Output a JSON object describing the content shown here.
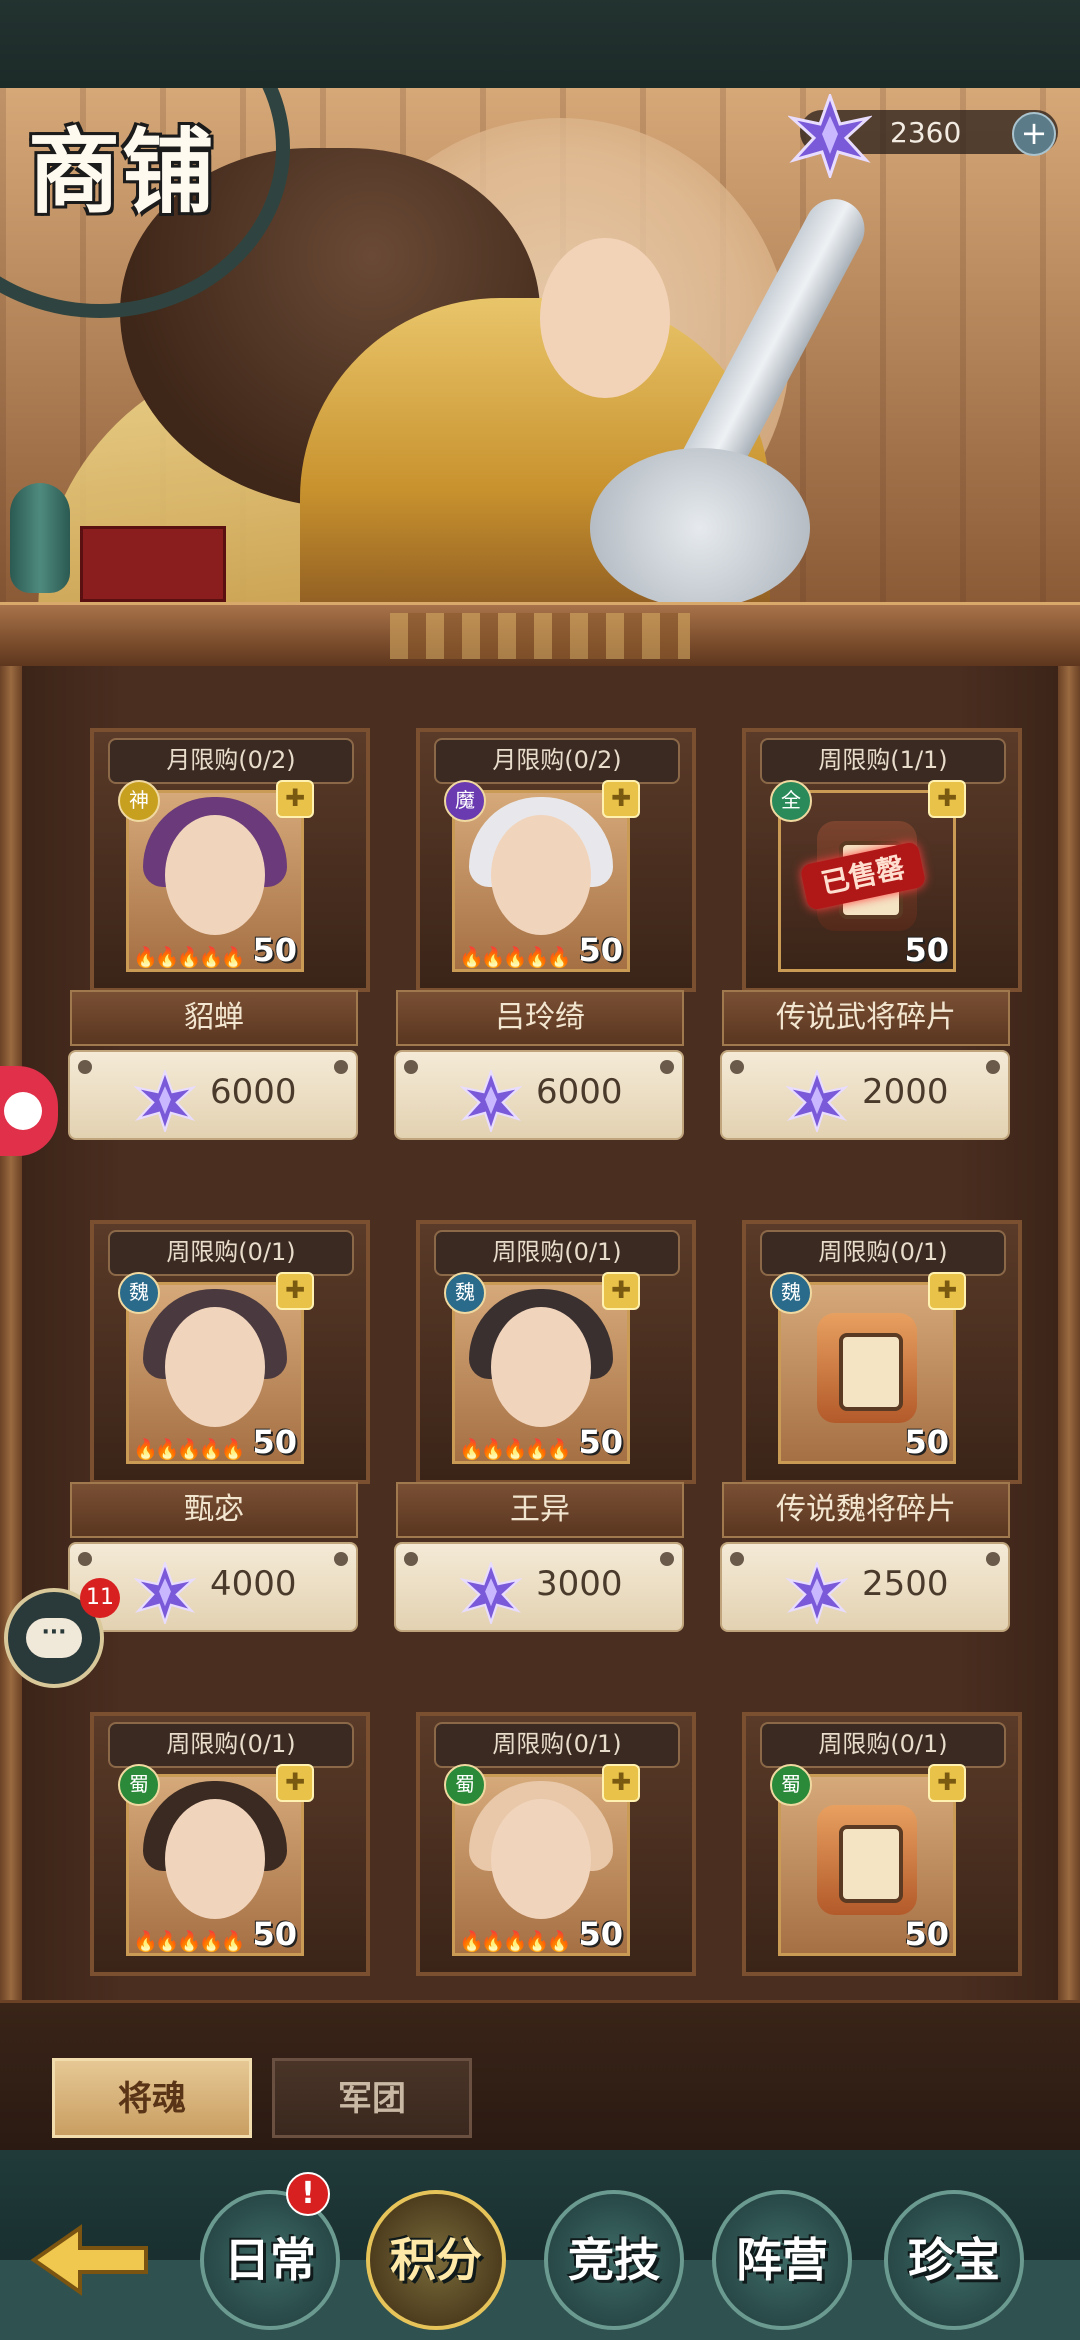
{
  "header": {
    "title": "商铺"
  },
  "currency": {
    "amount": "2360",
    "add_label": "+"
  },
  "items": [
    {
      "limit": "月限购(0/2)",
      "faction": "神",
      "faction_color": "#c8a020",
      "name": "貂蝉",
      "price": "6000",
      "level": "50",
      "stars": "5",
      "kind": "hero",
      "hair": "#6a3a7a",
      "sold": false
    },
    {
      "limit": "月限购(0/2)",
      "faction": "魔",
      "faction_color": "#6a3ab0",
      "name": "吕玲绮",
      "price": "6000",
      "level": "50",
      "stars": "5",
      "kind": "hero",
      "hair": "#e8e8ec",
      "sold": false
    },
    {
      "limit": "周限购(1/1)",
      "faction": "全",
      "faction_color": "#2a8a5a",
      "name": "传说武将碎片",
      "price": "2000",
      "level": "50",
      "stars": "",
      "kind": "fragment",
      "sold": true,
      "sold_label": "已售罄"
    },
    {
      "limit": "周限购(0/1)",
      "faction": "魏",
      "faction_color": "#2a6a8a",
      "name": "甄宓",
      "price": "4000",
      "level": "50",
      "stars": "5",
      "kind": "hero",
      "hair": "#4a3a40",
      "sold": false
    },
    {
      "limit": "周限购(0/1)",
      "faction": "魏",
      "faction_color": "#2a6a8a",
      "name": "王异",
      "price": "3000",
      "level": "50",
      "stars": "5",
      "kind": "hero",
      "hair": "#3a3030",
      "sold": false
    },
    {
      "limit": "周限购(0/1)",
      "faction": "魏",
      "faction_color": "#2a6a8a",
      "name": "传说魏将碎片",
      "price": "2500",
      "level": "50",
      "stars": "",
      "kind": "fragment",
      "sold": false
    },
    {
      "limit": "周限购(0/1)",
      "faction": "蜀",
      "faction_color": "#2a8a3a",
      "name": "",
      "price": "",
      "level": "50",
      "stars": "5",
      "kind": "hero",
      "hair": "#3a2a22",
      "sold": false
    },
    {
      "limit": "周限购(0/1)",
      "faction": "蜀",
      "faction_color": "#2a8a3a",
      "name": "",
      "price": "",
      "level": "50",
      "stars": "5",
      "kind": "hero",
      "hair": "#e8c8a8",
      "sold": false
    },
    {
      "limit": "周限购(0/1)",
      "faction": "蜀",
      "faction_color": "#2a8a3a",
      "name": "",
      "price": "",
      "level": "50",
      "stars": "",
      "kind": "fragment",
      "sold": false
    }
  ],
  "tabs": [
    {
      "label": "将魂",
      "active": true
    },
    {
      "label": "军团",
      "active": false
    }
  ],
  "nav": {
    "back_icon": "back-arrow-icon",
    "items": [
      {
        "label": "日常",
        "badge": "!"
      },
      {
        "label": "积分",
        "active": true
      },
      {
        "label": "竞技"
      },
      {
        "label": "阵营"
      },
      {
        "label": "珍宝"
      }
    ]
  },
  "chat": {
    "count": "11",
    "icon": "chat-icon"
  },
  "float": {
    "icon": "game-pad-icon"
  }
}
